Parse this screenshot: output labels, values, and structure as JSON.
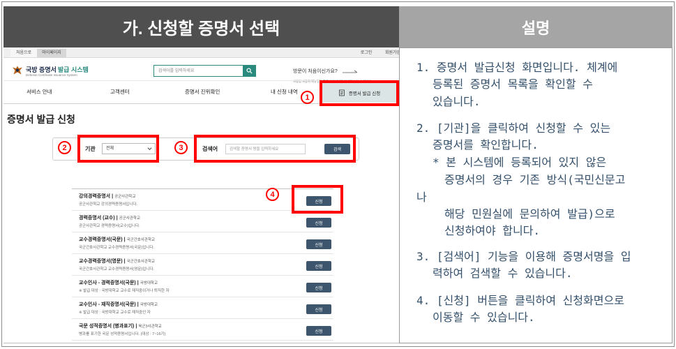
{
  "header": {
    "left_title": "가. 신청할 증명서 선택",
    "right_title": "설명"
  },
  "site": {
    "topbar": {
      "home": "처음으로",
      "mypage": "마이페이지",
      "login": "로그인",
      "join": "회원가입"
    },
    "logo": {
      "name_main": "국방 증명서",
      "name_accent": "발급 시스템",
      "subtitle": "Defense Certificate Issuance System"
    },
    "search": {
      "placeholder": "검색어를 입력하세요"
    },
    "help": {
      "title": "방문이 처음이신가요?",
      "desc": "사용법 사용자 메뉴얼을 통해 이용방법을 자세히 보실 수 있어요"
    },
    "nav": {
      "items": [
        "서비스 안내",
        "고객센터",
        "증명서 진위확인",
        "내 신청 내역"
      ],
      "active": "증명서 발급 신청"
    },
    "page_title": "증명서 발급 신청",
    "filter": {
      "org_label": "기관",
      "org_value": "전체",
      "keyword_label": "검색어",
      "keyword_placeholder": "검색할 증명서 명을 입력하세요",
      "search_button": "검색"
    },
    "list": {
      "separator": "|",
      "apply_label": "신청"
    },
    "certificates": [
      {
        "title": "강의경력증명서",
        "org": "공군사관학교",
        "desc": "공군사관학교 강의경력증명서입니다."
      },
      {
        "title": "경력증명서 (교수)",
        "org": "공군사관학교",
        "desc": "공군사관학교 경력증명서(교수)입니다."
      },
      {
        "title": "교수경력증명서(국문)",
        "org": "국군간호사관학교",
        "desc": "국군간호사관학교 교수경력증명서(국문)입니다."
      },
      {
        "title": "교수경력증명서(영문)",
        "org": "국군간호사관학교",
        "desc": "국군간호사관학교 교수경력증명서(영문)입니다."
      },
      {
        "title": "교수인사 - 경력증명서(국문)",
        "org": "국방대학교",
        "desc": "※ 발급 대상 : 국방대학교 교수로 재직중이거나 퇴직한 자"
      },
      {
        "title": "교수인사 - 재직증명서(국문)",
        "org": "국방대학교",
        "desc": "※ 발급 대상 : 국방대학교 교수로 재직중인 자"
      },
      {
        "title": "국문 성적증명서 (병과표기)",
        "org": "육군3사관학교",
        "desc": "병과를 표기한 국문 성적증명서입니다. (대상 : 7~16기)"
      }
    ]
  },
  "annotations": {
    "markers": [
      "1",
      "2",
      "3",
      "4"
    ]
  },
  "explanation": {
    "lines": [
      "1. 증명서 발급신청 화면입니다. 체계에",
      "등록된 증명서 목록을 확인할 수",
      "있습니다.",
      "2. [기관]을 클릭하여 신청할 수 있는",
      "증명서를 확인합니다.",
      "* 본 시스템에 등록되어 있지 않은",
      "증명서의 경우 기존 방식(국민신문고",
      "나",
      "해당 민원실에 문의하여 발급)으로",
      "신청하여야 합니다.",
      "3. [검색어] 기능을 이용해 증명서명을 입",
      "력하여 검색할 수 있습니다.",
      "4. [신청] 버튼을 클릭하여 신청화면으로",
      "이동할 수 있습니다."
    ]
  },
  "colors": {
    "annotation_red": "#ff0000",
    "accent_teal": "#2a8a7e",
    "button_navy": "#3d566d",
    "explanation_text": "#34506b",
    "header_dark": "#4f4f4f",
    "header_light": "#a5a5a5"
  },
  "icons": {
    "logo": "emblem-icon",
    "search": "search-icon",
    "help": "arrow-right-icon",
    "active_tab": "document-icon",
    "select": "chevron-down-icon"
  }
}
